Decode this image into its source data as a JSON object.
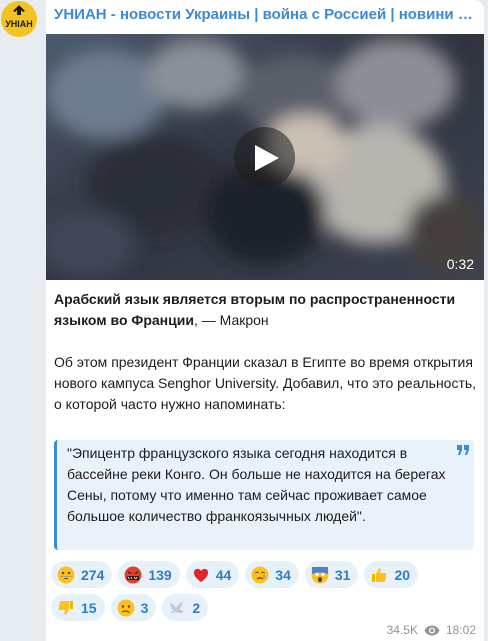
{
  "channel": {
    "title": "УНИАН - новости Украины | война с Россией | новини Україні...",
    "avatar_text": "УНІАН"
  },
  "video": {
    "duration": "0:32",
    "play_icon": "play-icon"
  },
  "post": {
    "headline_bold": "Арабский язык является вторым по распространенности языком во Франции",
    "headline_rest": ", — Макрон",
    "body": "Об этом президент Франции сказал в Египте во время открытия нового кампуса Senghor University. Добавил, что это реальность, о которой часто нужно напоминать:",
    "quote": "\"Эпицентр французского языка сегодня находится в бассейне реки Конго. Он больше не находится на берегах Сены, потому что именно там сейчас проживает самое большое количество франкоязычных людей\"."
  },
  "reactions": [
    {
      "icon": "grinning-face",
      "count": "274"
    },
    {
      "icon": "face-with-symbols",
      "count": "139"
    },
    {
      "icon": "red-heart",
      "count": "44"
    },
    {
      "icon": "crying-face",
      "count": "34"
    },
    {
      "icon": "screaming-face",
      "count": "31"
    },
    {
      "icon": "thumbs-up",
      "count": "20"
    },
    {
      "icon": "thumbs-down",
      "count": "15"
    },
    {
      "icon": "confused-face",
      "count": "3"
    },
    {
      "icon": "dove",
      "count": "2"
    }
  ],
  "meta": {
    "views": "34.5K",
    "time": "18:02"
  },
  "colors": {
    "accent": "#3a8bd6",
    "reaction_bg": "#e6f1fa",
    "quote_bg": "#e8f2fb"
  }
}
